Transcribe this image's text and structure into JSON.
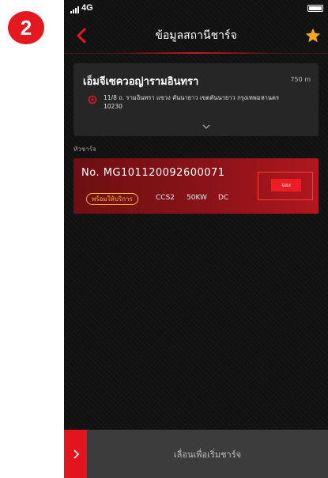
{
  "step": {
    "number": "2"
  },
  "status_bar": {
    "network": "4G"
  },
  "header": {
    "title": "ข้อมูลสถานีชาร์จ"
  },
  "station": {
    "name": "เอ็มจีเซควอญ่ารามอินทรา",
    "distance": "750 m",
    "address": "11/8 ถ. รามอินทรา แขวง คันนายาว เขตคันนายาว กรุงเทพมหานคร 10230"
  },
  "connectors": {
    "section_label": "หัวชาร์จ",
    "items": [
      {
        "id": "No. MG101120092600071",
        "status": "พร้อมให้บริการ",
        "type": "CCS2",
        "power": "50KW",
        "current": "DC",
        "action_label": "จอง"
      }
    ]
  },
  "bottom": {
    "slide_label": "เลื่อนเพื่อเริ่มชาร์จ"
  },
  "colors": {
    "accent": "#e3191f",
    "status": "#f2b632",
    "background": "#111111"
  },
  "icons": {
    "back": "chevron-left-icon",
    "favorite": "star-icon",
    "location": "location-pin-icon",
    "expand": "chevron-down-icon",
    "slide": "chevron-right-icon"
  }
}
